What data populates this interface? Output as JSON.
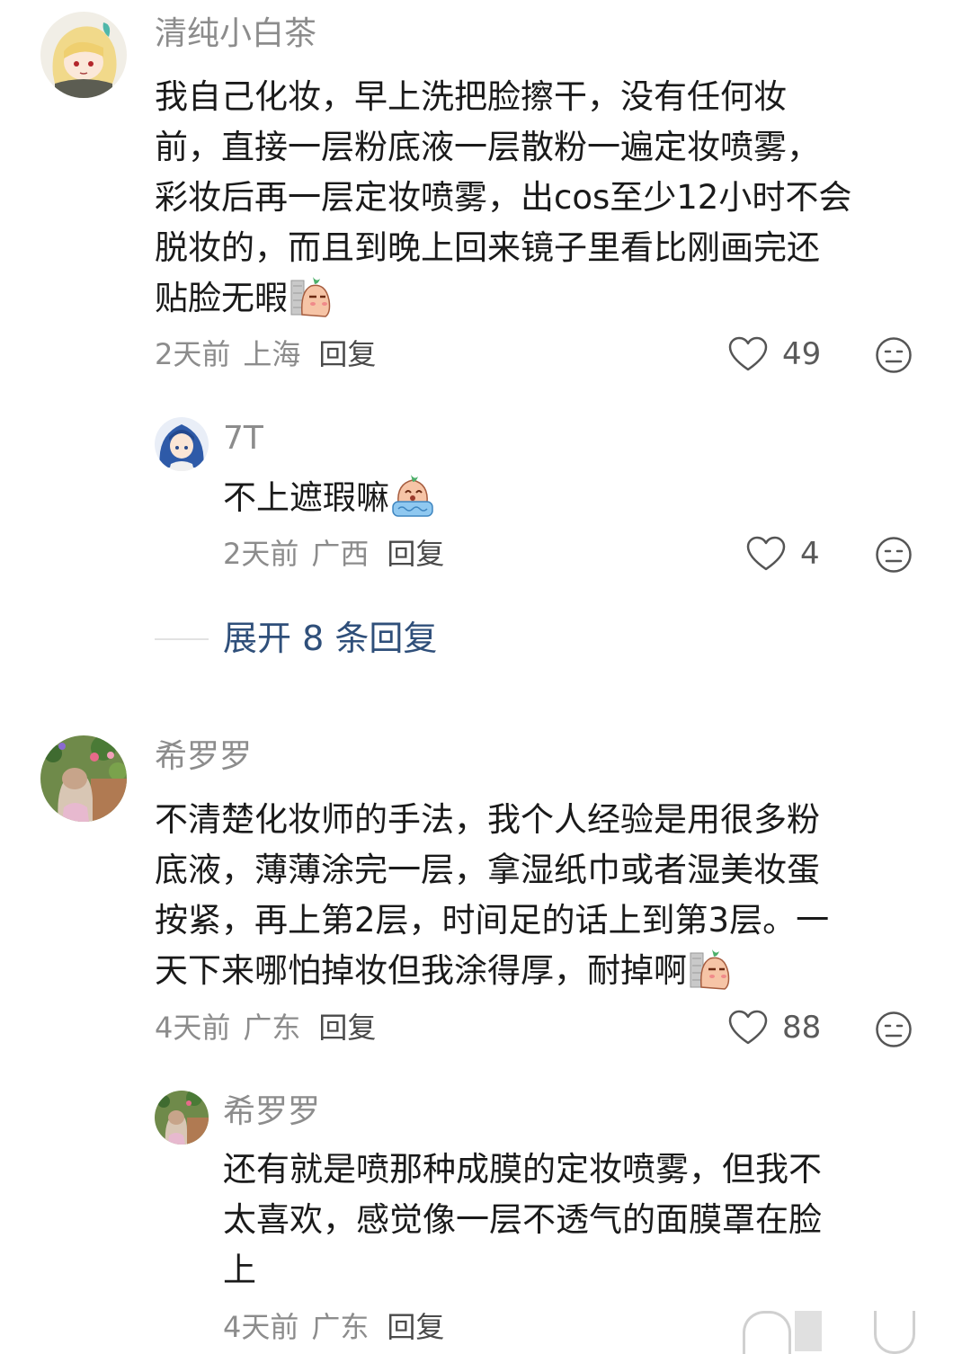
{
  "comments": [
    {
      "username": "清纯小白茶",
      "lines": [
        "我自己化妆，早上洗把脸擦干，没有任何妆",
        "前，直接一层粉底液一层散粉一遍定妆喷雾，",
        "彩妆后再一层定妆喷雾，出cos至少12小时不会",
        "脱妆的，而且到晚上回来镜子里看比刚画完还",
        "贴脸无暇"
      ],
      "time": "2天前",
      "location": "上海",
      "reply_label": "回复",
      "likes": "49"
    },
    {
      "username": "希罗罗",
      "lines": [
        "不清楚化妆师的手法，我个人经验是用很多粉",
        "底液，薄薄涂完一层，拿湿纸巾或者湿美妆蛋",
        "按紧，再上第2层，时间足的话上到第3层。一",
        "天下来哪怕掉妆但我涂得厚，耐掉啊"
      ],
      "time": "4天前",
      "location": "广东",
      "reply_label": "回复",
      "likes": "88"
    }
  ],
  "replies": [
    {
      "username": "7T",
      "lines": [
        "不上遮瑕嘛"
      ],
      "time": "2天前",
      "location": "广西",
      "reply_label": "回复",
      "likes": "4"
    },
    {
      "username": "希罗罗",
      "lines": [
        "还有就是喷那种成膜的定妆喷雾，但我不",
        "太喜欢，感觉像一层不透气的面膜罩在脸",
        "上"
      ],
      "time": "4天前",
      "location": "广东",
      "reply_label": "回复"
    }
  ],
  "expand_replies": "展开 8 条回复",
  "colors": {
    "link": "#2f4f7a",
    "meta": "#8c8c8c"
  }
}
